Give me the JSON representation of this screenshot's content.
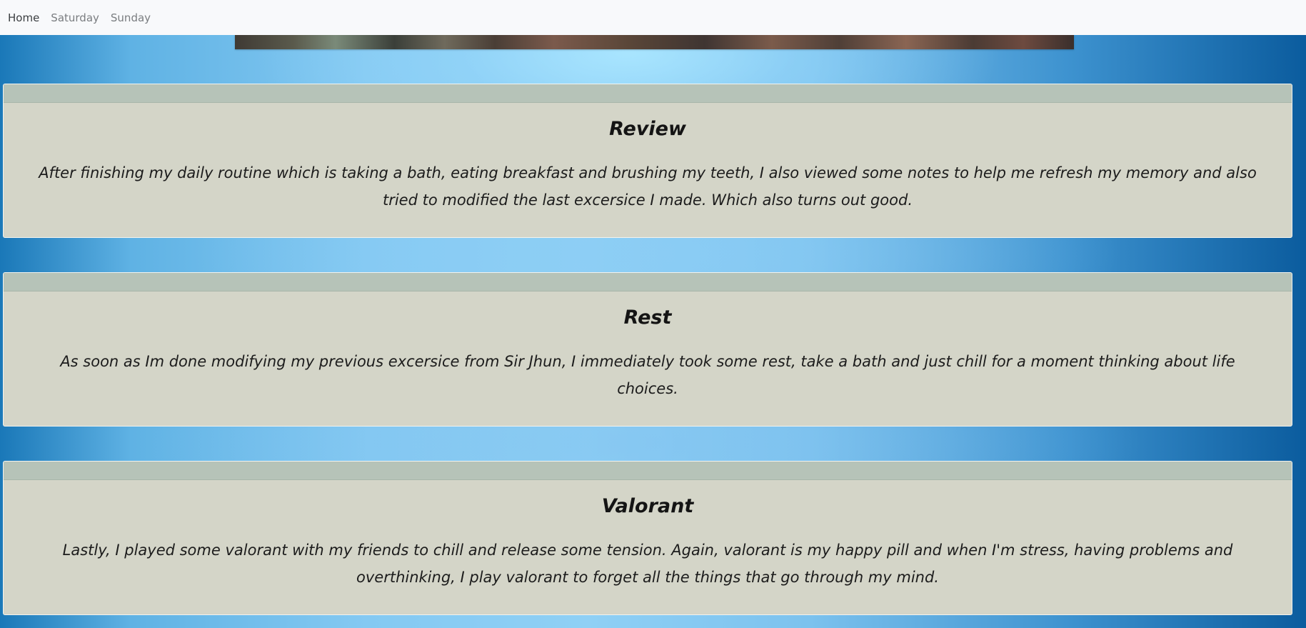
{
  "nav": {
    "items": [
      {
        "label": "Home"
      },
      {
        "label": "Saturday"
      },
      {
        "label": "Sunday"
      }
    ]
  },
  "cards": [
    {
      "title": "Review",
      "text": "After finishing my daily routine which is taking a bath, eating breakfast and brushing my teeth, I also viewed some notes to help me refresh my memory and also tried to modified the last excersice I made. Which also turns out good."
    },
    {
      "title": "Rest",
      "text": "As soon as Im done modifying my previous excersice from Sir Jhun, I immediately took some rest, take a bath and just chill for a moment thinking about life choices."
    },
    {
      "title": "Valorant",
      "text": "Lastly, I played some valorant with my friends to chill and release some tension. Again, valorant is my happy pill and when I'm stress, having problems and overthinking, I play valorant to forget all the things that go through my mind."
    }
  ],
  "colors": {
    "card_background": "#d4d5c8",
    "card_header": "#b6c3b8",
    "navbar_background": "#f8f9fb",
    "page_background": "#5fb2e4"
  }
}
